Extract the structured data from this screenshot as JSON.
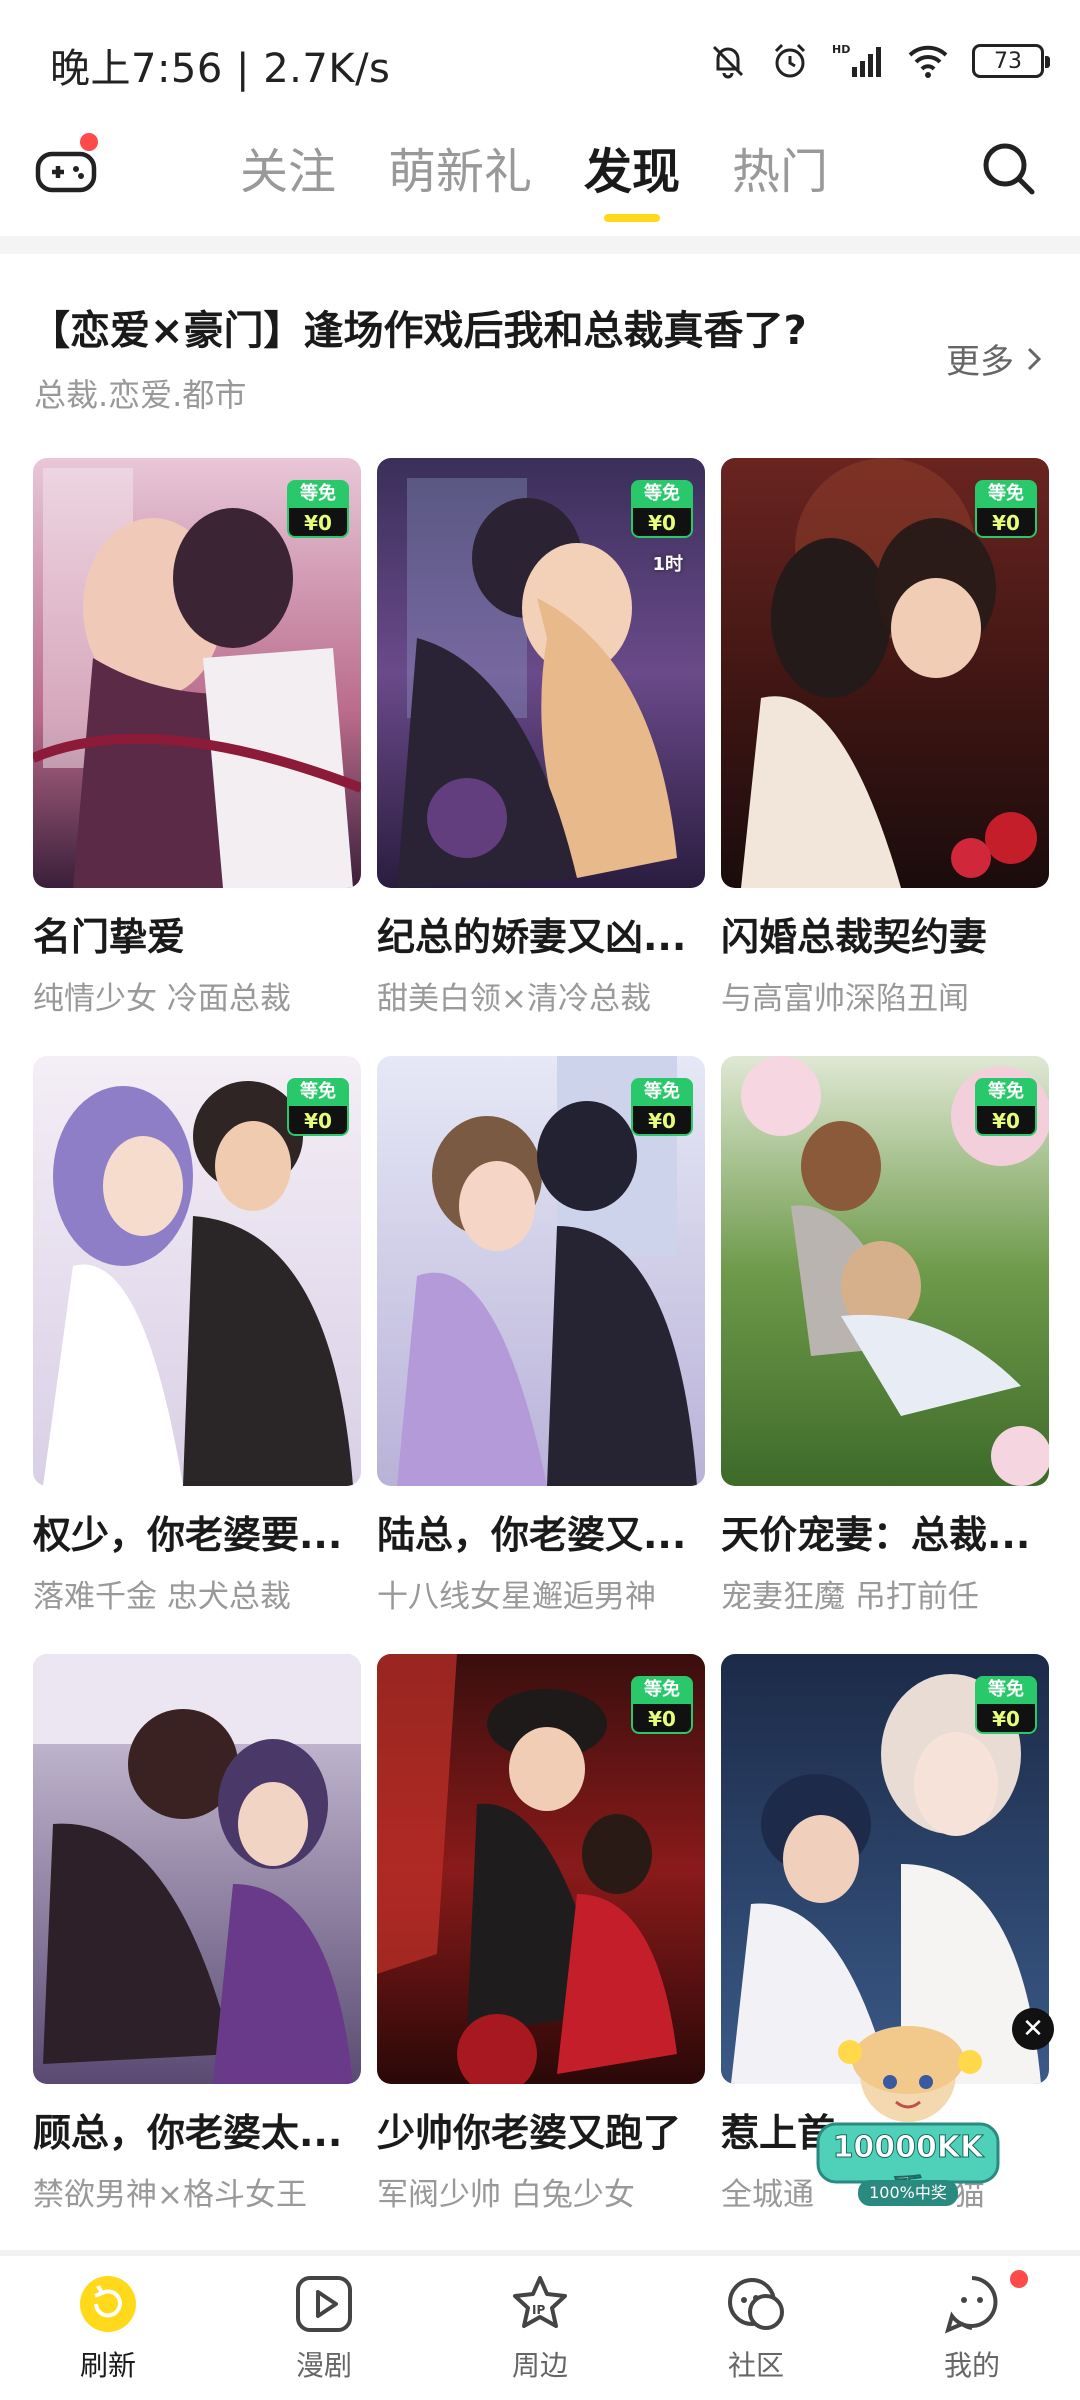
{
  "status_bar": {
    "time_speed": "晚上7:56 | 2.7K/s",
    "battery": "73"
  },
  "top_nav": {
    "tabs": [
      {
        "label": "关注"
      },
      {
        "label": "萌新礼"
      },
      {
        "label": "发现"
      },
      {
        "label": "热门"
      }
    ],
    "active_tab": "发现",
    "accent_color": "#ffd91a"
  },
  "section": {
    "title": "【恋爱×豪门】逢场作戏后我和总裁真香了?",
    "subtitle": "总裁.恋爱.都市",
    "more_label": "更多"
  },
  "cards": [
    {
      "title": "名门挚爱",
      "subtitle": "纯情少女 冷面总裁",
      "badge_top": "等免",
      "badge_bottom": "¥0"
    },
    {
      "title": "纪总的娇妻又凶...",
      "subtitle": "甜美白领×清冷总裁",
      "badge_top": "等免",
      "badge_bottom": "¥0",
      "badge_time": "1时"
    },
    {
      "title": "闪婚总裁契约妻",
      "subtitle": "与高富帅深陷丑闻",
      "badge_top": "等免",
      "badge_bottom": "¥0"
    },
    {
      "title": "权少，你老婆要...",
      "subtitle": "落难千金 忠犬总裁",
      "badge_top": "等免",
      "badge_bottom": "¥0"
    },
    {
      "title": "陆总，你老婆又...",
      "subtitle": "十八线女星邂逅男神",
      "badge_top": "等免",
      "badge_bottom": "¥0"
    },
    {
      "title": "天价宠妻：总裁...",
      "subtitle": "宠妻狂魔 吊打前任",
      "badge_top": "等免",
      "badge_bottom": "¥0"
    },
    {
      "title": "顾总，你老婆太...",
      "subtitle": "禁欲男神×格斗女王"
    },
    {
      "title": "少帅你老婆又跑了",
      "subtitle": "军阀少帅 白兔少女",
      "badge_top": "等免",
      "badge_bottom": "¥0"
    },
    {
      "title": "惹上首",
      "subtitle": "全城通",
      "subtitle_tail": "猫",
      "badge_top": "等免",
      "badge_bottom": "¥0"
    }
  ],
  "promo": {
    "text": "10000KK币",
    "subtext": "100%中奖"
  },
  "bottom_nav": [
    {
      "label": "刷新",
      "icon": "refresh-icon"
    },
    {
      "label": "漫剧",
      "icon": "play-icon"
    },
    {
      "label": "周边",
      "icon": "ip-star-icon"
    },
    {
      "label": "社区",
      "icon": "community-icon"
    },
    {
      "label": "我的",
      "icon": "profile-icon"
    }
  ]
}
